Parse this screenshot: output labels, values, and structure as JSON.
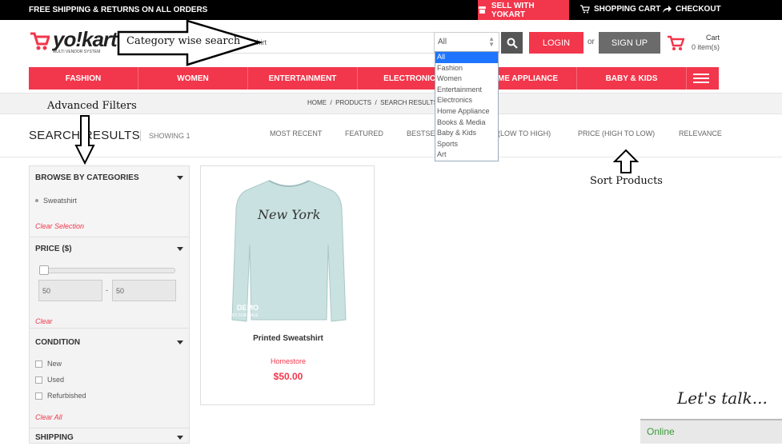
{
  "topbar": {
    "shipping": "FREE SHIPPING & RETURNS ON ALL ORDERS",
    "sell": "SELL WITH YOKART",
    "cart": "SHOPPING CART",
    "checkout": "CHECKOUT",
    "accent": "#f2364b"
  },
  "header": {
    "logo": "yo!kart",
    "logo_tag": "MULTI VENDOR SYSTEM",
    "search_value": "shirt",
    "category_selected": "All",
    "login": "LOGIN",
    "or": "or",
    "signup": "SIGN UP",
    "cart_label": "Cart",
    "cart_items": "0 item(s)"
  },
  "nav": [
    "FASHION",
    "WOMEN",
    "ENTERTAINMENT",
    "ELECTRONICS",
    "HOME APPLIANCE",
    "BABY & KIDS"
  ],
  "category_dropdown": [
    "All",
    "Fashion",
    "Women",
    "Entertainment",
    "Electronics",
    "Home Appliance",
    "Books & Media",
    "Baby & Kids",
    "Sports",
    "Art"
  ],
  "breadcrumb": "HOME  /  PRODUCTS  /  SEARCH RESULTS",
  "results": {
    "title": "SEARCH RESULTS",
    "showing": "SHOWING 1",
    "sorts": [
      "MOST RECENT",
      "FEATURED",
      "BESTSELLERS",
      "PRICE (LOW TO HIGH)",
      "PRICE (HIGH TO LOW)",
      "RELEVANCE"
    ]
  },
  "filters": {
    "categories_title": "BROWSE BY CATEGORIES",
    "category_item": "Sweatshirt",
    "clear_selection": "Clear Selection",
    "price_title": "PRICE ($)",
    "price_min": "50",
    "price_max": "50",
    "price_dash": "-",
    "price_clear": "Clear",
    "condition_title": "CONDITION",
    "conditions": [
      "New",
      "Used",
      "Refurbished"
    ],
    "clear_all": "Clear All",
    "shipping_title": "SHIPPING"
  },
  "product": {
    "name": "Printed Sweatshirt",
    "store": "Homestore",
    "price": "$50.00",
    "print": "New York",
    "demo": "DEMO",
    "demo_sub": "NOT FOR SALE"
  },
  "annotations": {
    "category_search": "Category wise search",
    "advanced_filters": "Advanced Filters",
    "sort_products": "Sort Products"
  },
  "chat": {
    "online": "Online",
    "lets_talk": "Let's talk..."
  }
}
